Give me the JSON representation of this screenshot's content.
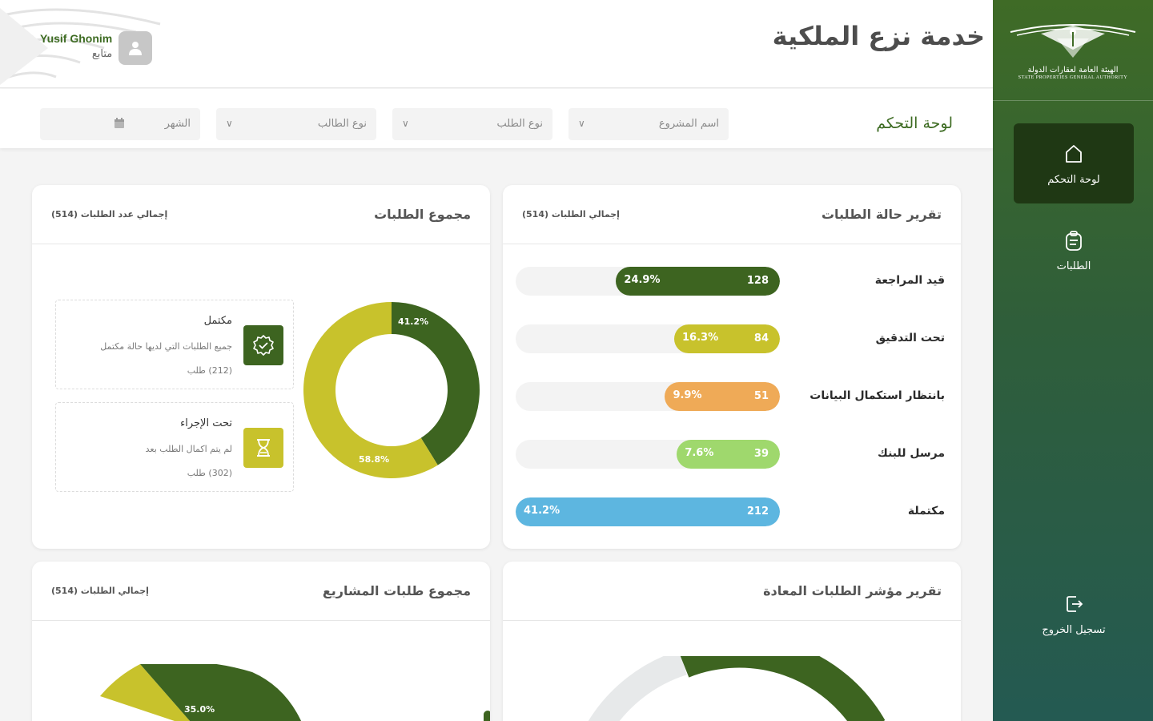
{
  "app": {
    "title": "خدمة نزع الملكية",
    "logo_ar": "الهيئة العامة لعقارات الدولة",
    "logo_en": "STATE PROPERTIES GENERAL AUTHORITY"
  },
  "user": {
    "name": "Yusif Ghonim",
    "role": "متابع"
  },
  "sidebar": {
    "items": [
      {
        "label": "لوحة التحكم",
        "icon": "home-icon",
        "active": true
      },
      {
        "label": "الطلبات",
        "icon": "clipboard-icon",
        "active": false
      },
      {
        "label": "تسجيل الخروج",
        "icon": "logout-icon",
        "active": false
      }
    ]
  },
  "filters": {
    "title": "لوحة التحكم",
    "project": "اسم المشروع",
    "request_type": "نوع الطلب",
    "applicant_type": "نوع الطالب",
    "month": "الشهر"
  },
  "status_report": {
    "title": "تقرير حالة الطلبات",
    "subtitle": "إجمالي الطلبات (514)",
    "rows": [
      {
        "name": "قيد المراجعة",
        "count": "128",
        "pct": "24.9%",
        "fraction": 0.62,
        "color": "#3d6420"
      },
      {
        "name": "تحت التدقيق",
        "count": "84",
        "pct": "16.3%",
        "fraction": 0.4,
        "color": "#c8c22c"
      },
      {
        "name": "بانتظار استكمال البيانات",
        "count": "51",
        "pct": "9.9%",
        "fraction": 0.435,
        "color": "#efaa57"
      },
      {
        "name": "مرسل للبنك",
        "count": "39",
        "pct": "7.6%",
        "fraction": 0.39,
        "color": "#9fd86d"
      },
      {
        "name": "مكتملة",
        "count": "212",
        "pct": "41.2%",
        "fraction": 1.0,
        "color": "#5db6e0"
      }
    ]
  },
  "requests_total": {
    "title": "مجموع الطلبات",
    "subtitle": "إجمالي عدد الطلبات (514)",
    "legend": [
      {
        "title": "مكتمل",
        "desc": "جميع الطلبات التي لديها حالة مكتمل",
        "count": "(212) طلب",
        "icon": "verified-badge-icon",
        "color": "#3d6420"
      },
      {
        "title": "تحت الإجراء",
        "desc": "لم يتم اكمال الطلب بعد",
        "count": "(302) طلب",
        "icon": "hourglass-icon",
        "color": "#c8c22c"
      }
    ]
  },
  "projects_total": {
    "title": "مجموع طلبات المشاريع",
    "subtitle": "إجمالي الطلبات (514)"
  },
  "returned_report": {
    "title": "تقرير مؤشر الطلبات المعادة"
  },
  "chart_data": [
    {
      "type": "pie",
      "title": "مجموع الطلبات",
      "categories": [
        "مكتمل",
        "تحت الإجراء"
      ],
      "values": [
        41.2,
        58.8
      ],
      "labels": [
        "41.2%",
        "58.8%"
      ],
      "colors": [
        "#3d6420",
        "#c8c22c"
      ]
    },
    {
      "type": "pie",
      "title": "مجموع طلبات المشاريع",
      "values": [
        35.0
      ],
      "labels": [
        "35.0%"
      ],
      "colors": [
        "#3d6420",
        "#c8c22c"
      ]
    }
  ]
}
